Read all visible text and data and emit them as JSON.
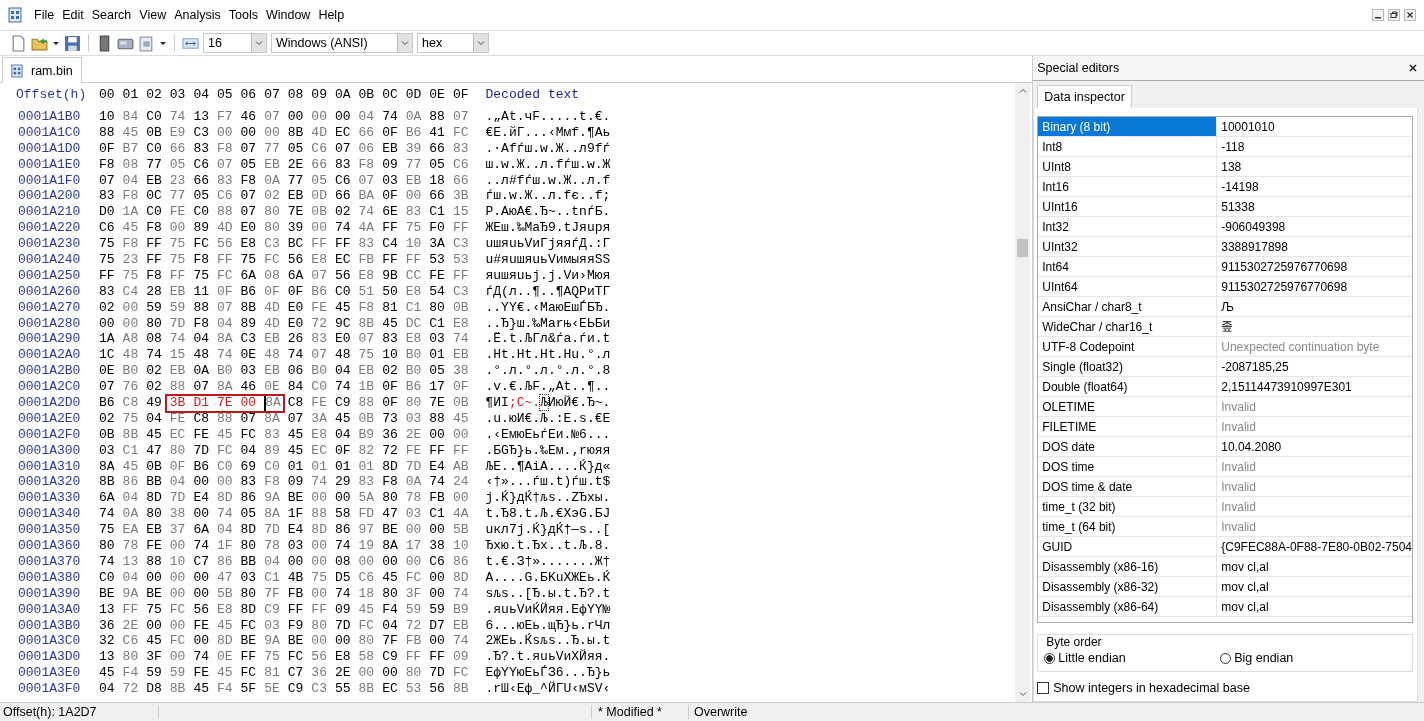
{
  "menu": [
    "File",
    "Edit",
    "Search",
    "View",
    "Analysis",
    "Tools",
    "Window",
    "Help"
  ],
  "toolbar": {
    "bytes_per_row": "16",
    "charset": "Windows (ANSI)",
    "offset_base": "hex"
  },
  "tabs": [
    {
      "label": "ram.bin",
      "selected": true
    }
  ],
  "hex_view": {
    "header": {
      "offset": "Offset(h)",
      "columns": [
        "00",
        "01",
        "02",
        "03",
        "04",
        "05",
        "06",
        "07",
        "08",
        "09",
        "0A",
        "0B",
        "0C",
        "0D",
        "0E",
        "0F"
      ],
      "decoded": "Decoded text"
    },
    "annotation_box": true,
    "rows": [
      {
        "offset": "0001A1B0",
        "bytes": [
          "10",
          "84",
          "C0",
          "74",
          "13",
          "F7",
          "46",
          "07",
          "00",
          "00",
          "00",
          "04",
          "74",
          "0A",
          "88",
          "07"
        ],
        "text": ".„Аt.чF.....t.€."
      },
      {
        "offset": "0001A1C0",
        "bytes": [
          "88",
          "45",
          "0B",
          "E9",
          "C3",
          "00",
          "00",
          "00",
          "8B",
          "4D",
          "EC",
          "66",
          "0F",
          "B6",
          "41",
          "FC"
        ],
        "text": "€E.йГ...‹Mмf.¶Aь"
      },
      {
        "offset": "0001A1D0",
        "bytes": [
          "0F",
          "B7",
          "C0",
          "66",
          "83",
          "F8",
          "07",
          "77",
          "05",
          "C6",
          "07",
          "06",
          "EB",
          "39",
          "66",
          "83"
        ],
        "text": ".·Аfѓш.w.Ж..л9fѓ"
      },
      {
        "offset": "0001A1E0",
        "bytes": [
          "F8",
          "08",
          "77",
          "05",
          "C6",
          "07",
          "05",
          "EB",
          "2E",
          "66",
          "83",
          "F8",
          "09",
          "77",
          "05",
          "C6"
        ],
        "text": "ш.w.Ж..л.fѓш.w.Ж"
      },
      {
        "offset": "0001A1F0",
        "bytes": [
          "07",
          "04",
          "EB",
          "23",
          "66",
          "83",
          "F8",
          "0A",
          "77",
          "05",
          "C6",
          "07",
          "03",
          "EB",
          "18",
          "66"
        ],
        "text": "..л#fѓш.w.Ж..л.f"
      },
      {
        "offset": "0001A200",
        "bytes": [
          "83",
          "F8",
          "0C",
          "77",
          "05",
          "C6",
          "07",
          "02",
          "EB",
          "0D",
          "66",
          "BA",
          "0F",
          "00",
          "66",
          "3B"
        ],
        "text": "ѓш.w.Ж..л.fє..f;"
      },
      {
        "offset": "0001A210",
        "bytes": [
          "D0",
          "1A",
          "C0",
          "FE",
          "C0",
          "88",
          "07",
          "80",
          "7E",
          "0B",
          "02",
          "74",
          "6E",
          "83",
          "C1",
          "15"
        ],
        "text": "Р.АюА€.Ђ~..tnѓБ."
      },
      {
        "offset": "0001A220",
        "bytes": [
          "C6",
          "45",
          "F8",
          "00",
          "89",
          "4D",
          "E0",
          "80",
          "39",
          "00",
          "74",
          "4A",
          "FF",
          "75",
          "F0",
          "FF"
        ],
        "text": "ЖEш.‰MаЂ9.tJяuря"
      },
      {
        "offset": "0001A230",
        "bytes": [
          "75",
          "F8",
          "FF",
          "75",
          "FC",
          "56",
          "E8",
          "C3",
          "BC",
          "FF",
          "FF",
          "83",
          "C4",
          "10",
          "3A",
          "C3"
        ],
        "text": "uшяuьVиГјяяѓД.:Г"
      },
      {
        "offset": "0001A240",
        "bytes": [
          "75",
          "23",
          "FF",
          "75",
          "F8",
          "FF",
          "75",
          "FC",
          "56",
          "E8",
          "EC",
          "FB",
          "FF",
          "FF",
          "53",
          "53"
        ],
        "text": "u#яuшяuьVимыяяSS"
      },
      {
        "offset": "0001A250",
        "bytes": [
          "FF",
          "75",
          "F8",
          "FF",
          "75",
          "FC",
          "6A",
          "08",
          "6A",
          "07",
          "56",
          "E8",
          "9B",
          "CC",
          "FE",
          "FF"
        ],
        "text": "яuшяuьj.j.Vи›Мюя"
      },
      {
        "offset": "0001A260",
        "bytes": [
          "83",
          "C4",
          "28",
          "EB",
          "11",
          "0F",
          "B6",
          "0F",
          "0F",
          "B6",
          "C0",
          "51",
          "50",
          "E8",
          "54",
          "C3"
        ],
        "text": "ѓД(л..¶..¶АQPиTГ"
      },
      {
        "offset": "0001A270",
        "bytes": [
          "02",
          "00",
          "59",
          "59",
          "88",
          "07",
          "8B",
          "4D",
          "E0",
          "FE",
          "45",
          "F8",
          "81",
          "C1",
          "80",
          "0B"
        ],
        "text": "..YY€.‹MаюEшЃБЂ."
      },
      {
        "offset": "0001A280",
        "bytes": [
          "00",
          "00",
          "80",
          "7D",
          "F8",
          "04",
          "89",
          "4D",
          "E0",
          "72",
          "9C",
          "8B",
          "45",
          "DC",
          "C1",
          "E8"
        ],
        "text": "..Ђ}ш.‰Mаrњ‹EЬБи"
      },
      {
        "offset": "0001A290",
        "bytes": [
          "1A",
          "A8",
          "08",
          "74",
          "04",
          "8A",
          "C3",
          "EB",
          "26",
          "83",
          "E0",
          "07",
          "83",
          "E8",
          "03",
          "74"
        ],
        "text": ".Ё.t.ЉГл&ѓа.ѓи.t"
      },
      {
        "offset": "0001A2A0",
        "bytes": [
          "1C",
          "48",
          "74",
          "15",
          "48",
          "74",
          "0E",
          "48",
          "74",
          "07",
          "48",
          "75",
          "10",
          "B0",
          "01",
          "EB"
        ],
        "text": ".Ht.Ht.Ht.Hu.°.л"
      },
      {
        "offset": "0001A2B0",
        "bytes": [
          "0E",
          "B0",
          "02",
          "EB",
          "0A",
          "B0",
          "03",
          "EB",
          "06",
          "B0",
          "04",
          "EB",
          "02",
          "B0",
          "05",
          "38"
        ],
        "text": ".°.л.°.л.°.л.°.8"
      },
      {
        "offset": "0001A2C0",
        "bytes": [
          "07",
          "76",
          "02",
          "88",
          "07",
          "8A",
          "46",
          "0E",
          "84",
          "C0",
          "74",
          "1B",
          "0F",
          "B6",
          "17",
          "0F"
        ],
        "text": ".v.€.ЉF.„Аt..¶.."
      },
      {
        "offset": "0001A2D0",
        "bytes": [
          "B6",
          "C8",
          "49",
          {
            "value": "3B",
            "modified": true
          },
          {
            "value": "D1",
            "modified": true
          },
          {
            "value": "7E",
            "modified": true
          },
          {
            "value": "00",
            "modified": true
          },
          {
            "value": "8A",
            "selected": true
          },
          "C8",
          "FE",
          "C9",
          "88",
          "0F",
          "80",
          "7E",
          "0B"
        ],
        "text": [
          {
            "text": "¶ИI"
          },
          {
            "text": ";С~.",
            "modified": true
          },
          {
            "text": "Љ",
            "selected": true
          },
          {
            "text": "ИюЙ€.Ђ~."
          }
        ]
      },
      {
        "offset": "0001A2E0",
        "bytes": [
          "02",
          "75",
          "04",
          "FE",
          "C8",
          "88",
          "07",
          "8A",
          "07",
          "3A",
          "45",
          "0B",
          "73",
          "03",
          "88",
          "45"
        ],
        "text": ".u.юИ€.Љ.:E.s.€E"
      },
      {
        "offset": "0001A2F0",
        "bytes": [
          "0B",
          "8B",
          "45",
          "EC",
          "FE",
          "45",
          "FC",
          "83",
          "45",
          "E8",
          "04",
          "B9",
          "36",
          "2E",
          "00",
          "00"
        ],
        "text": ".‹EмюEьѓEи.№6..."
      },
      {
        "offset": "0001A300",
        "bytes": [
          "03",
          "C1",
          "47",
          "80",
          "7D",
          "FC",
          "04",
          "89",
          "45",
          "EC",
          "0F",
          "82",
          "72",
          "FE",
          "FF",
          "FF"
        ],
        "text": ".БGЂ}ь.‰Eм.‚rюяя"
      },
      {
        "offset": "0001A310",
        "bytes": [
          "8A",
          "45",
          "0B",
          "0F",
          "B6",
          "C0",
          "69",
          "C0",
          "01",
          "01",
          "01",
          "01",
          "8D",
          "7D",
          "E4",
          "AB"
        ],
        "text": "ЉE..¶АiА....Ќ}д«"
      },
      {
        "offset": "0001A320",
        "bytes": [
          "8B",
          "86",
          "BB",
          "04",
          "00",
          "00",
          "83",
          "F8",
          "09",
          "74",
          "29",
          "83",
          "F8",
          "0A",
          "74",
          "24"
        ],
        "text": "‹†»...ѓш.t)ѓш.t$"
      },
      {
        "offset": "0001A330",
        "bytes": [
          "6A",
          "04",
          "8D",
          "7D",
          "E4",
          "8D",
          "86",
          "9A",
          "BE",
          "00",
          "00",
          "5A",
          "80",
          "78",
          "FB",
          "00"
        ],
        "text": "j.Ќ}дЌ†љѕ..ZЂxы."
      },
      {
        "offset": "0001A340",
        "bytes": [
          "74",
          "0A",
          "80",
          "38",
          "00",
          "74",
          "05",
          "8A",
          "1F",
          "88",
          "58",
          "FD",
          "47",
          "03",
          "C1",
          "4A"
        ],
        "text": "t.Ђ8.t.Љ.€XэG.БJ"
      },
      {
        "offset": "0001A350",
        "bytes": [
          "75",
          "EA",
          "EB",
          "37",
          "6A",
          "04",
          "8D",
          "7D",
          "E4",
          "8D",
          "86",
          "97",
          "BE",
          "00",
          "00",
          "5B"
        ],
        "text": "uкл7j.Ќ}дЌ†—ѕ..["
      },
      {
        "offset": "0001A360",
        "bytes": [
          "80",
          "78",
          "FE",
          "00",
          "74",
          "1F",
          "80",
          "78",
          "03",
          "00",
          "74",
          "19",
          "8A",
          "17",
          "38",
          "10"
        ],
        "text": "Ђxю.t.Ђx..t.Љ.8."
      },
      {
        "offset": "0001A370",
        "bytes": [
          "74",
          "13",
          "88",
          "10",
          "C7",
          "86",
          "BB",
          "04",
          "00",
          "00",
          "08",
          "00",
          "00",
          "00",
          "C6",
          "86"
        ],
        "text": "t.€.З†».......Ж†"
      },
      {
        "offset": "0001A380",
        "bytes": [
          "C0",
          "04",
          "00",
          "00",
          "00",
          "47",
          "03",
          "C1",
          "4B",
          "75",
          "D5",
          "C6",
          "45",
          "FC",
          "00",
          "8D"
        ],
        "text": "А....G.БKuХЖEь.Ќ"
      },
      {
        "offset": "0001A390",
        "bytes": [
          "BE",
          "9A",
          "BE",
          "00",
          "00",
          "5B",
          "80",
          "7F",
          "FB",
          "00",
          "74",
          "18",
          "80",
          "3F",
          "00",
          "74"
        ],
        "text": "ѕљѕ..[Ђ.ы.t.Ђ?.t"
      },
      {
        "offset": "0001A3A0",
        "bytes": [
          "13",
          "FF",
          "75",
          "FC",
          "56",
          "E8",
          "8D",
          "C9",
          "FF",
          "FF",
          "09",
          "45",
          "F4",
          "59",
          "59",
          "B9"
        ],
        "text": ".яuьVиЌЙяя.EфYY№"
      },
      {
        "offset": "0001A3B0",
        "bytes": [
          "36",
          "2E",
          "00",
          "00",
          "FE",
          "45",
          "FC",
          "03",
          "F9",
          "80",
          "7D",
          "FC",
          "04",
          "72",
          "D7",
          "EB"
        ],
        "text": "6...юEь.щЂ}ь.rЧл"
      },
      {
        "offset": "0001A3C0",
        "bytes": [
          "32",
          "C6",
          "45",
          "FC",
          "00",
          "8D",
          "BE",
          "9A",
          "BE",
          "00",
          "00",
          "80",
          "7F",
          "FB",
          "00",
          "74"
        ],
        "text": "2ЖEь.Ќѕљѕ..Ђ.ы.t"
      },
      {
        "offset": "0001A3D0",
        "bytes": [
          "13",
          "80",
          "3F",
          "00",
          "74",
          "0E",
          "FF",
          "75",
          "FC",
          "56",
          "E8",
          "58",
          "C9",
          "FF",
          "FF",
          "09"
        ],
        "text": ".Ђ?.t.яuьVиXЙяя."
      },
      {
        "offset": "0001A3E0",
        "bytes": [
          "45",
          "F4",
          "59",
          "59",
          "FE",
          "45",
          "FC",
          "81",
          "C7",
          "36",
          "2E",
          "00",
          "00",
          "80",
          "7D",
          "FC"
        ],
        "text": "EфYYюEьЃЗ6...Ђ}ь"
      },
      {
        "offset": "0001A3F0",
        "bytes": [
          "04",
          "72",
          "D8",
          "8B",
          "45",
          "F4",
          "5F",
          "5E",
          "C9",
          "C3",
          "55",
          "8B",
          "EC",
          "53",
          "56",
          "8B"
        ],
        "text": ".rШ‹Eф_^ЙГU‹мSV‹"
      }
    ]
  },
  "inspector": {
    "title": "Special editors",
    "tab": "Data inspector",
    "rows": [
      {
        "name": "Binary (8 bit)",
        "value": "10001010",
        "selected": true,
        "dimmed": false
      },
      {
        "name": "Int8",
        "value": "-118",
        "selected": false,
        "dimmed": false
      },
      {
        "name": "UInt8",
        "value": "138",
        "selected": false,
        "dimmed": false
      },
      {
        "name": "Int16",
        "value": "-14198",
        "selected": false,
        "dimmed": false
      },
      {
        "name": "UInt16",
        "value": "51338",
        "selected": false,
        "dimmed": false
      },
      {
        "name": "Int32",
        "value": "-906049398",
        "selected": false,
        "dimmed": false
      },
      {
        "name": "UInt32",
        "value": "3388917898",
        "selected": false,
        "dimmed": false
      },
      {
        "name": "Int64",
        "value": "9115302725976770698",
        "selected": false,
        "dimmed": false
      },
      {
        "name": "UInt64",
        "value": "9115302725976770698",
        "selected": false,
        "dimmed": false
      },
      {
        "name": "AnsiChar / char8_t",
        "value": "Љ",
        "selected": false,
        "dimmed": false
      },
      {
        "name": "WideChar / char16_t",
        "value": "좊",
        "selected": false,
        "dimmed": false
      },
      {
        "name": "UTF-8 Codepoint",
        "value": "Unexpected continuation byte",
        "selected": false,
        "dimmed": true
      },
      {
        "name": "Single (float32)",
        "value": "-2087185,25",
        "selected": false,
        "dimmed": false
      },
      {
        "name": "Double (float64)",
        "value": "2,15114473910997E301",
        "selected": false,
        "dimmed": false
      },
      {
        "name": "OLETIME",
        "value": "Invalid",
        "selected": false,
        "dimmed": true
      },
      {
        "name": "FILETIME",
        "value": "Invalid",
        "selected": false,
        "dimmed": true
      },
      {
        "name": "DOS date",
        "value": "10.04.2080",
        "selected": false,
        "dimmed": false
      },
      {
        "name": "DOS time",
        "value": "Invalid",
        "selected": false,
        "dimmed": true
      },
      {
        "name": "DOS time & date",
        "value": "Invalid",
        "selected": false,
        "dimmed": true
      },
      {
        "name": "time_t (32 bit)",
        "value": "Invalid",
        "selected": false,
        "dimmed": true
      },
      {
        "name": "time_t (64 bit)",
        "value": "Invalid",
        "selected": false,
        "dimmed": true
      },
      {
        "name": "GUID",
        "value": "{C9FEC88A-0F88-7E80-0B02-7504",
        "selected": false,
        "dimmed": false
      },
      {
        "name": "Disassembly (x86-16)",
        "value": "mov cl,al",
        "selected": false,
        "dimmed": false
      },
      {
        "name": "Disassembly (x86-32)",
        "value": "mov cl,al",
        "selected": false,
        "dimmed": false
      },
      {
        "name": "Disassembly (x86-64)",
        "value": "mov cl,al",
        "selected": false,
        "dimmed": false
      }
    ],
    "byte_order": {
      "label": "Byte order",
      "options": [
        {
          "label": "Little endian",
          "selected": true
        },
        {
          "label": "Big endian",
          "selected": false
        }
      ]
    },
    "hex_integers": {
      "label": "Show integers in hexadecimal base",
      "checked": false
    }
  },
  "status_bar": {
    "offset": "Offset(h): 1A2D7",
    "modified": "* Modified *",
    "mode": "Overwrite"
  }
}
